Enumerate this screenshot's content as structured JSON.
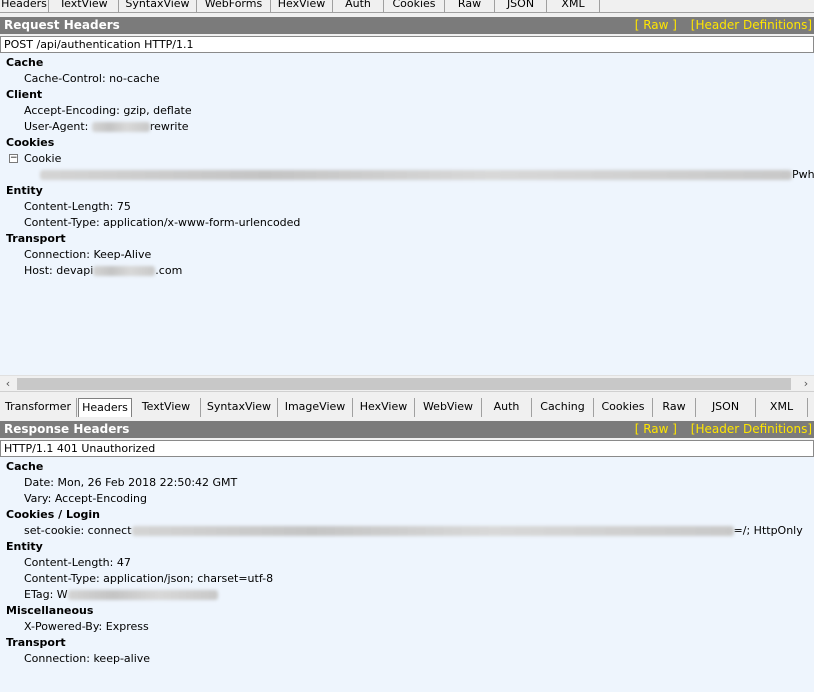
{
  "request": {
    "tabs": [
      "Headers",
      "TextView",
      "SyntaxView",
      "WebForms",
      "HexView",
      "Auth",
      "Cookies",
      "Raw",
      "JSON",
      "XML"
    ],
    "title": "Request Headers",
    "links": [
      "[ Raw ]",
      "[Header Definitions]"
    ],
    "request_line": "POST /api/authentication HTTP/1.1",
    "groups": {
      "cache": "Cache",
      "cache_control": "Cache-Control: no-cache",
      "client": "Client",
      "accept_encoding": "Accept-Encoding: gzip, deflate",
      "user_agent_prefix": "User-Agent: ",
      "user_agent_suffix": "rewrite",
      "cookies": "Cookies",
      "cookie": "Cookie",
      "cookie_value_tail": "Pwh",
      "entity": "Entity",
      "content_length": "Content-Length: 75",
      "content_type": "Content-Type: application/x-www-form-urlencoded",
      "transport": "Transport",
      "connection": "Connection: Keep-Alive",
      "host_prefix": "Host: devapi",
      "host_suffix": ".com"
    }
  },
  "response": {
    "tabs": [
      "Transformer",
      "Headers",
      "TextView",
      "SyntaxView",
      "ImageView",
      "HexView",
      "WebView",
      "Auth",
      "Caching",
      "Cookies",
      "Raw",
      "JSON",
      "XML"
    ],
    "title": "Response Headers",
    "links": [
      "[ Raw ]",
      "[Header Definitions]"
    ],
    "status_line": "HTTP/1.1 401 Unauthorized",
    "groups": {
      "cache": "Cache",
      "date": "Date: Mon, 26 Feb 2018 22:50:42 GMT",
      "vary": "Vary: Accept-Encoding",
      "cookies_login": "Cookies / Login",
      "set_cookie_prefix": "set-cookie: connect",
      "set_cookie_suffix": "=/; HttpOnly",
      "entity": "Entity",
      "content_length": "Content-Length: 47",
      "content_type": "Content-Type: application/json; charset=utf-8",
      "etag_prefix": "ETag: W",
      "misc": "Miscellaneous",
      "powered_by": "X-Powered-By: Express",
      "transport": "Transport",
      "connection": "Connection: keep-alive"
    }
  },
  "colors": {
    "title_bg": "#7b7b7b",
    "link": "#ffe600",
    "pane_bg": "#eef5fd"
  }
}
